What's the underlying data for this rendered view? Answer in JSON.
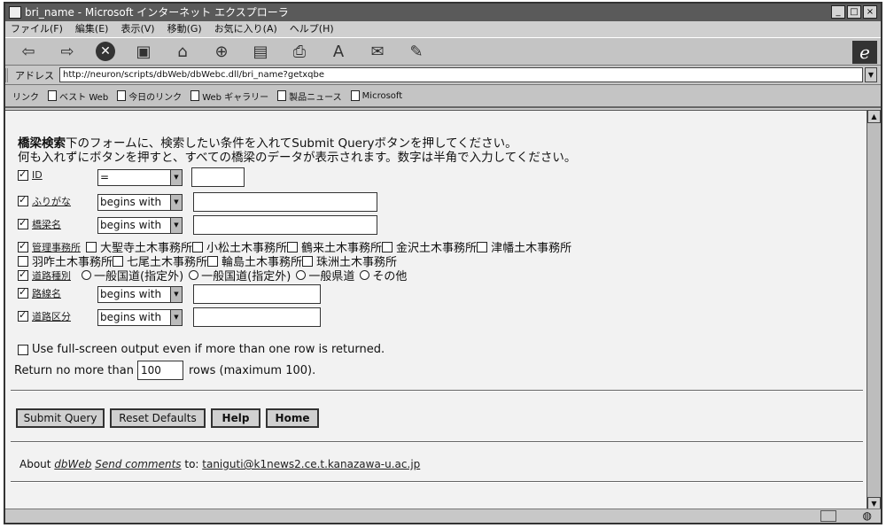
{
  "window": {
    "title": "bri_name - Microsoft インターネット エクスプローラ",
    "min": "_",
    "max": "□",
    "close": "×"
  },
  "menu": [
    "ファイル(F)",
    "編集(E)",
    "表示(V)",
    "移動(G)",
    "お気に入り(A)",
    "ヘルプ(H)"
  ],
  "toolbar_icons": [
    "back-icon",
    "forward-icon",
    "stop-icon",
    "refresh-icon",
    "home-icon",
    "search-icon",
    "favorites-icon",
    "print-icon",
    "font-icon",
    "mail-icon",
    "edit-icon"
  ],
  "address": {
    "label": "アドレス",
    "url": "http://neuron/scripts/dbWeb/dbWebc.dll/bri_name?getxqbe"
  },
  "links": {
    "label": "リンク",
    "items": [
      "ベスト Web",
      "今日のリンク",
      "Web ギャラリー",
      "製品ニュース",
      "Microsoft"
    ]
  },
  "intro": {
    "title": "橋梁検索",
    "line1": "下のフォームに、検索したい条件を入れてSubmit Queryボタンを押してください。",
    "line2": "何も入れずにボタンを押すと、すべての橋梁のデータが表示されます。数字は半角で入力してください。"
  },
  "fields": [
    {
      "label": "ID",
      "operator": "=",
      "value": "",
      "checked": true
    },
    {
      "label": "ふりがな",
      "operator": "begins with",
      "value": "",
      "checked": true
    },
    {
      "label": "橋梁名",
      "operator": "begins with",
      "value": "",
      "checked": true
    },
    {
      "label": "路線名",
      "operator": "begins with",
      "value": "",
      "checked": true
    },
    {
      "label": "道路区分",
      "operator": "begins with",
      "value": "",
      "checked": true
    }
  ],
  "office": {
    "label": "管理事務所",
    "checked": true,
    "options": [
      "大聖寺土木事務所",
      "小松土木事務所",
      "鶴来土木事務所",
      "金沢土木事務所",
      "津幡土木事務所",
      "羽咋土木事務所",
      "七尾土木事務所",
      "輪島土木事務所",
      "珠洲土木事務所"
    ]
  },
  "road_type": {
    "label": "道路種別",
    "checked": true,
    "options": [
      "一般国道(指定外)",
      "一般国道(指定外)",
      "一般県道",
      "その他"
    ]
  },
  "fullscreen_label": "Use full-screen output even if more than one row is returned.",
  "return_limit": {
    "prefix": "Return no more than",
    "value": "100",
    "suffix": "rows (maximum 100)."
  },
  "buttons": {
    "submit": "Submit Query",
    "reset": "Reset Defaults",
    "help": "Help",
    "home": "Home"
  },
  "footer": {
    "about_prefix": "About ",
    "about_link": "dbWeb",
    "send": "Send comments",
    "to": " to: ",
    "email": "taniguti@k1news2.ce.t.kanazawa-u.ac.jp"
  }
}
